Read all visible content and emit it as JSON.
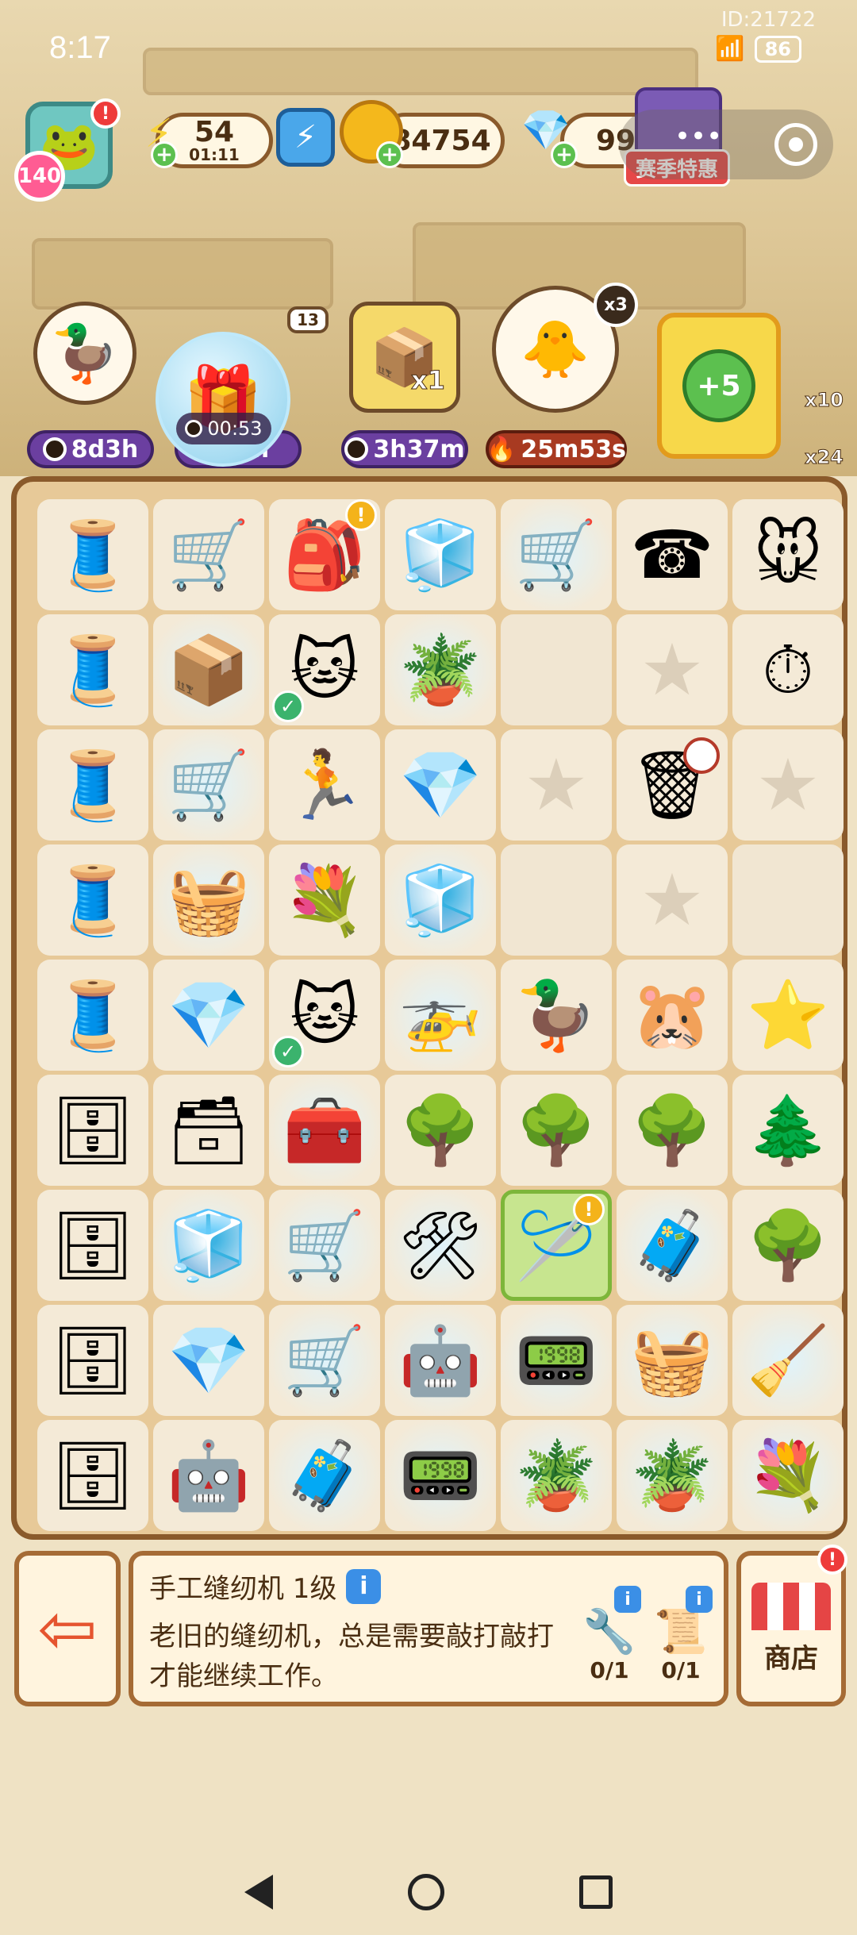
{
  "status_bar": {
    "time": "8:17",
    "device_id": "ID:21722",
    "battery": "86"
  },
  "player": {
    "level": "140",
    "avatar_icon": "frog-avatar"
  },
  "resources": {
    "energy_value": "54",
    "energy_timer": "01:11",
    "coins": "84754",
    "gems": "99"
  },
  "event": {
    "label": "赛季特惠"
  },
  "characters": [
    {
      "name": "pilot-duck",
      "timer": "8d3h"
    },
    {
      "name": "witch-character",
      "timer": "3h",
      "bubble_timer": "00:53",
      "badge": "13"
    },
    {
      "name": "gift-box-character",
      "timer": "3h37m",
      "multiplier": "x1"
    },
    {
      "name": "chef-duck",
      "timer": "25m53s",
      "multiplier": "x3"
    }
  ],
  "bonus_card": {
    "label": "+5"
  },
  "side_counts": {
    "flower": "x10",
    "gear": "x24"
  },
  "board": {
    "rows": [
      [
        "sewing-machine",
        "trolley-duck",
        "backpack",
        "fridge-pink",
        "cart",
        "phone",
        "mouse-toy"
      ],
      [
        "sewing-machine",
        "box-cart",
        "cat-bed",
        "potted-plant",
        "empty",
        "star",
        "stopwatch"
      ],
      [
        "sewing-machine",
        "shopping-cart",
        "treadmill",
        "gem",
        "star",
        "trash-bag",
        "star"
      ],
      [
        "sewing-machine",
        "basket",
        "flower-basket",
        "fridge-open",
        "empty",
        "star",
        "empty"
      ],
      [
        "sewing-machine",
        "gems-pile",
        "cat-bed",
        "drone",
        "duck-figure",
        "hamster",
        "star-toy"
      ],
      [
        "cabinet",
        "small-cabinet",
        "green-machine",
        "tree",
        "tree",
        "tree",
        "topiary"
      ],
      [
        "tall-cabinet",
        "fridge-pink",
        "cart-duck",
        "cart-machine",
        "sewing-figure",
        "green-case",
        "tree"
      ],
      [
        "tall-cabinet",
        "gems-pile",
        "cart-yellow",
        "robot-vacuum",
        "green-station",
        "wicker-basket",
        "vacuum-station"
      ],
      [
        "tall-cabinet",
        "robot-vacuum",
        "green-case",
        "green-station",
        "potted-plant",
        "potted-plant",
        "flower-basket"
      ]
    ],
    "special_icons": {
      "sewing-machine": "🧵",
      "trolley-duck": "🛒",
      "backpack": "🎒",
      "fridge-pink": "🧊",
      "cart": "🛒",
      "phone": "☎",
      "mouse-toy": "🐭",
      "box-cart": "📦",
      "cat-bed": "🐱",
      "potted-plant": "🪴",
      "stopwatch": "⏱",
      "shopping-cart": "🛒",
      "treadmill": "🏃",
      "gem": "💎",
      "trash-bag": "🗑",
      "basket": "🧺",
      "flower-basket": "💐",
      "fridge-open": "🧊",
      "gems-pile": "💎",
      "drone": "🚁",
      "duck-figure": "🦆",
      "hamster": "🐹",
      "star-toy": "⭐",
      "cabinet": "🗄",
      "small-cabinet": "🗃",
      "green-machine": "🧰",
      "tree": "🌳",
      "topiary": "🌲",
      "tall-cabinet": "🗄",
      "cart-duck": "🛒",
      "cart-machine": "🛠",
      "sewing-figure": "🪡",
      "green-case": "🧳",
      "cart-yellow": "🛒",
      "robot-vacuum": "🤖",
      "green-station": "📟",
      "wicker-basket": "🧺",
      "vacuum-station": "🧹"
    }
  },
  "selected_item": {
    "title": "手工缝纫机 1级",
    "description": "老旧的缝纫机，总是需要敲打敲打才能继续工作。",
    "requirements": [
      {
        "icon": "drill",
        "count": "0/1"
      },
      {
        "icon": "scroll",
        "count": "0/1"
      }
    ]
  },
  "shop": {
    "label": "商店"
  }
}
